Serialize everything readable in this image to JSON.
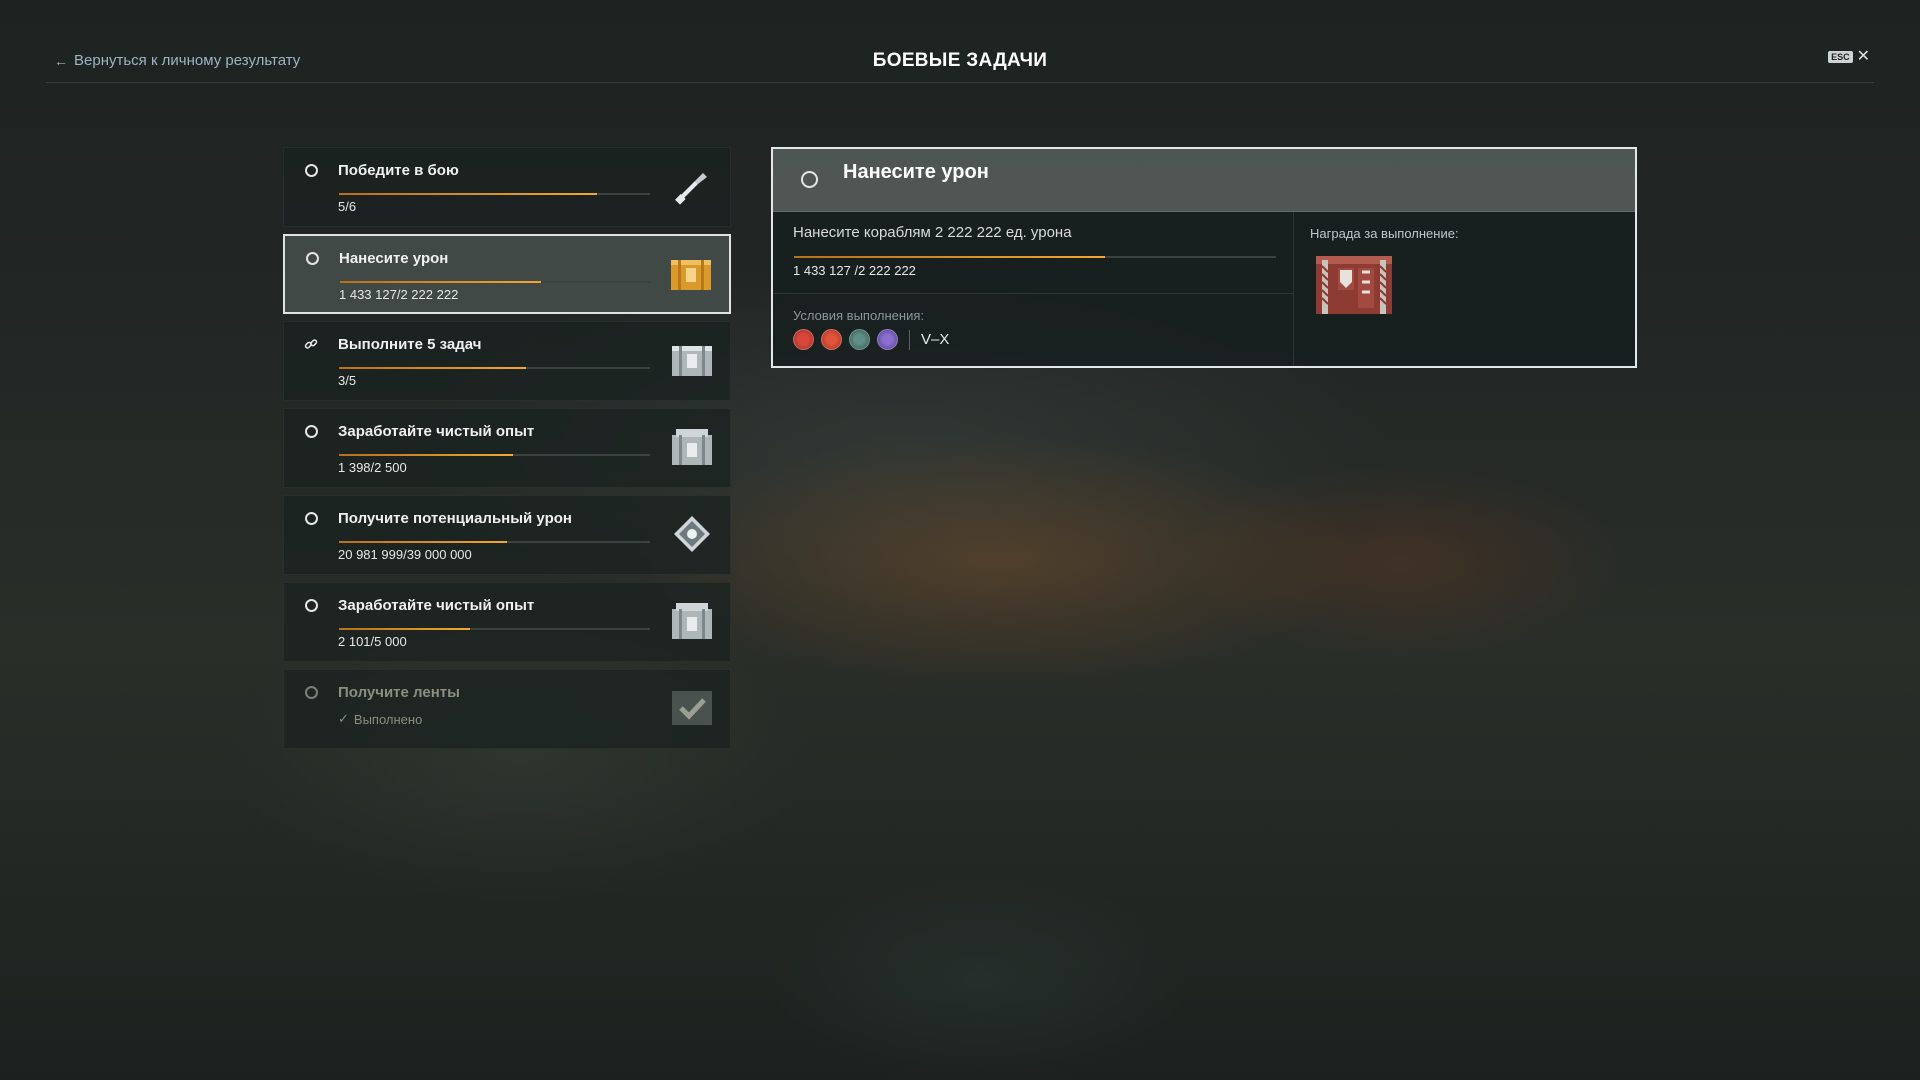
{
  "header": {
    "back_label": "Вернуться к личному результату",
    "title": "БОЕВЫЕ ЗАДАЧИ",
    "esc_label": "ESC",
    "close_symbol": "✕"
  },
  "tasks": [
    {
      "title": "Победите в бою",
      "current": "5",
      "total": "6",
      "progress": 0.83,
      "icon": "circle-status",
      "reward": "brush-icon"
    },
    {
      "title": "Нанесите урон",
      "current": "1 433 127",
      "total": "2 222 222",
      "progress": 0.645,
      "icon": "circle-status",
      "reward": "gold-container-icon",
      "selected": true
    },
    {
      "title": "Выполните 5 задач",
      "current": "3",
      "total": "5",
      "progress": 0.6,
      "icon": "link-icon",
      "reward": "silver-container-icon"
    },
    {
      "title": "Заработайте чистый опыт",
      "current": "1 398",
      "total": "2 500",
      "progress": 0.56,
      "icon": "circle-status",
      "reward": "silver-container-icon"
    },
    {
      "title": "Получите потенциальный урон",
      "current": "20 981 999",
      "total": "39 000 000",
      "progress": 0.54,
      "icon": "circle-status",
      "reward": "diamond-icon"
    },
    {
      "title": "Заработайте чистый опыт",
      "current": "2 101",
      "total": "5 000",
      "progress": 0.42,
      "icon": "circle-status",
      "reward": "silver-container-icon"
    },
    {
      "title": "Получите ленты",
      "status_text": "Выполнено",
      "icon": "circle-status",
      "reward": "check-icon",
      "done": true
    }
  ],
  "detail": {
    "title": "Нанесите урон",
    "description": "Нанесите кораблям 2 222 222 ед. урона",
    "current": "1 433 127",
    "total": "2 222 222",
    "progress": 0.645,
    "conditions_label": "Условия выполнения:",
    "nations": [
      "japan-nation-icon",
      "ussr-nation-icon",
      "pan-asia-nation-icon",
      "europe-nation-icon"
    ],
    "tiers": "V–X",
    "reward_label": "Награда за выполнение:",
    "reward_icon": "red-container-icon"
  },
  "colors": {
    "progress": "#f2a830",
    "accent_text": "#9fb3c2",
    "done_text": "#8a8f7e"
  }
}
